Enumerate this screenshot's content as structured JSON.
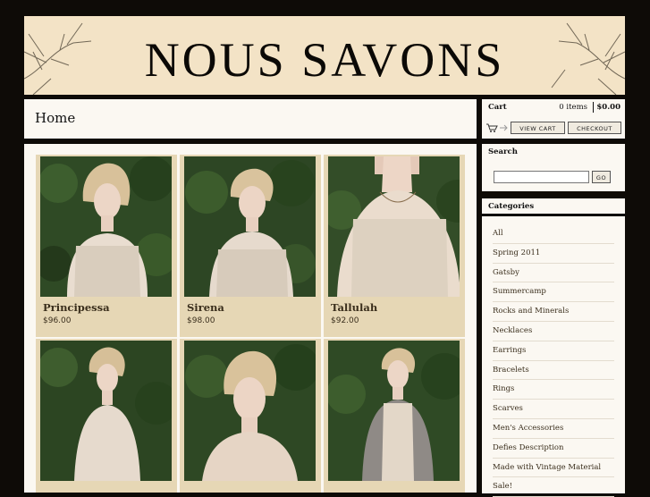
{
  "header": {
    "logo_text": "NOUS SAVONS"
  },
  "page": {
    "title": "Home"
  },
  "cart": {
    "label": "Cart",
    "items": "0 items",
    "total": "$0.00",
    "view_cart_label": "VIEW CART",
    "checkout_label": "CHECKOUT"
  },
  "search": {
    "title": "Search",
    "go_label": "GO",
    "placeholder": ""
  },
  "categories": {
    "title": "Categories",
    "items": [
      "All",
      "Spring 2011",
      "Gatsby",
      "Summercamp",
      "Rocks and Minerals",
      "Necklaces",
      "Earrings",
      "Bracelets",
      "Rings",
      "Scarves",
      "Men's Accessories",
      "Defies Description",
      "Made with Vintage Material",
      "Sale!"
    ]
  },
  "products": [
    {
      "name": "Principessa",
      "price": "$96.00"
    },
    {
      "name": "Sirena",
      "price": "$98.00"
    },
    {
      "name": "Tallulah",
      "price": "$92.00"
    },
    {
      "name": "",
      "price": ""
    },
    {
      "name": "",
      "price": ""
    },
    {
      "name": "",
      "price": ""
    }
  ],
  "colors": {
    "background": "#0e0b07",
    "banner": "#f3e3c6",
    "card": "#e6d7b5",
    "panel": "#fbf8f2",
    "text": "#3a2e1c"
  }
}
